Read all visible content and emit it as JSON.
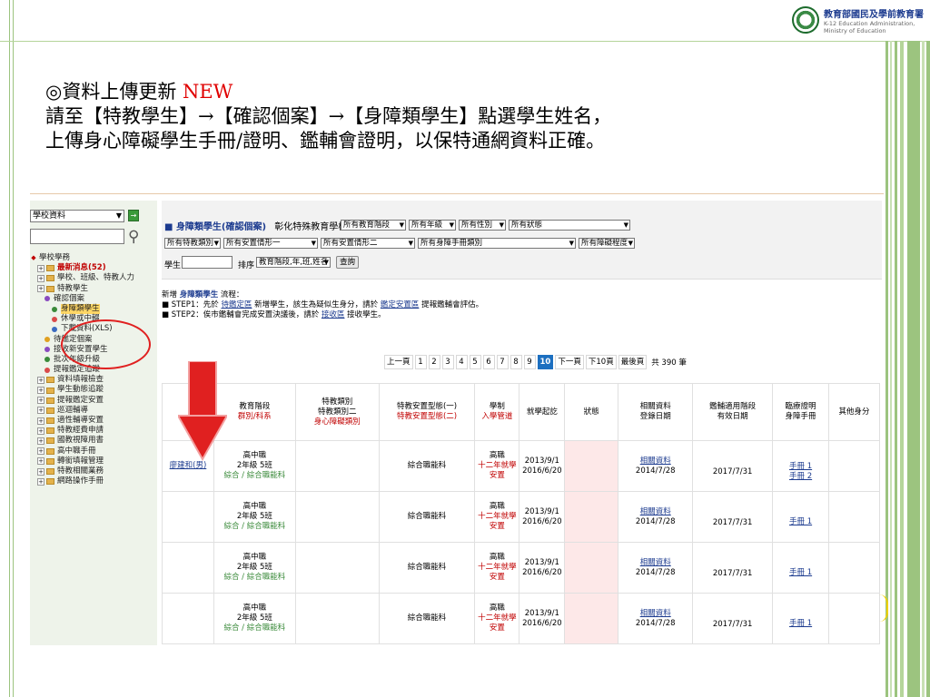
{
  "logo": {
    "title": "教育部國民及學前教育署",
    "en_line1": "K-12 Education Administration,",
    "en_line2": "Ministry of Education"
  },
  "heading": {
    "line1_prefix": "◎資料上傳更新 ",
    "line1_new": "NEW",
    "line2": "請至【特教學生】→【確認個案】→【身障類學生】點選學生姓名，",
    "line3": "上傳身心障礙學生手冊/證明、鑑輔會證明，以保特通網資料正確。"
  },
  "sidebar": {
    "select_value": "學校資料",
    "tree": [
      {
        "label": "學校學務",
        "indent": 0,
        "kind": "root"
      },
      {
        "label": "最新消息(52)",
        "indent": 1,
        "kind": "folder",
        "red": true
      },
      {
        "label": "學校、班級、特教人力",
        "indent": 1,
        "kind": "folder"
      },
      {
        "label": "特教學生",
        "indent": 1,
        "kind": "folder"
      },
      {
        "label": "確認個案",
        "indent": 2,
        "kind": "dot"
      },
      {
        "label": "身障類學生",
        "indent": 3,
        "kind": "dot",
        "selected": true
      },
      {
        "label": "休學或中輟",
        "indent": 3,
        "kind": "dot"
      },
      {
        "label": "下載資料(XLS)",
        "indent": 3,
        "kind": "dot"
      },
      {
        "label": "待鑑定個案",
        "indent": 2,
        "kind": "dot"
      },
      {
        "label": "接收新安置學生",
        "indent": 2,
        "kind": "dot"
      },
      {
        "label": "批次年級升級",
        "indent": 2,
        "kind": "dot"
      },
      {
        "label": "提報鑑定追蹤",
        "indent": 2,
        "kind": "dot"
      },
      {
        "label": "資料填報檢查",
        "indent": 1,
        "kind": "folder"
      },
      {
        "label": "學生動態追蹤",
        "indent": 1,
        "kind": "folder"
      },
      {
        "label": "提報鑑定安置",
        "indent": 1,
        "kind": "folder"
      },
      {
        "label": "巡迴輔導",
        "indent": 1,
        "kind": "folder"
      },
      {
        "label": "適性輔導安置",
        "indent": 1,
        "kind": "folder"
      },
      {
        "label": "特教經費申請",
        "indent": 1,
        "kind": "folder"
      },
      {
        "label": "國教視障用書",
        "indent": 1,
        "kind": "folder"
      },
      {
        "label": "高中職手冊",
        "indent": 1,
        "kind": "folder"
      },
      {
        "label": "轉銜填報管理",
        "indent": 1,
        "kind": "folder"
      },
      {
        "label": "特教相關業務",
        "indent": 1,
        "kind": "folder"
      },
      {
        "label": "網路操作手冊",
        "indent": 1,
        "kind": "folder"
      }
    ]
  },
  "filter": {
    "title_prefix": "■ ",
    "title_bold": "身障類學生(確認個案)",
    "title_school": "彰化特殊教育學校",
    "sel_stage": "所有教育階段",
    "sel_grade": "所有年級",
    "sel_gender": "所有性別",
    "sel_status": "所有狀態",
    "sel_type": "所有特教類別",
    "sel_place1": "所有安置情形一",
    "sel_place2": "所有安置情形二",
    "sel_manual": "所有身障手冊類別",
    "sel_degree": "所有障礙程度",
    "student_label": "學生",
    "sort_label": "排序",
    "sort_value": "教育階段,年,班,姓名",
    "query_button": "查詢"
  },
  "steps": {
    "line0_prefix": "新增 ",
    "line0_bold": "身障類學生",
    "line0_suffix": " 流程：",
    "step1_a": "■ STEP1：先於 ",
    "step1_link1": "待鑑定區",
    "step1_b": " 新增學生，該生為疑似生身分，請於 ",
    "step1_link2": "鑑定安置區",
    "step1_c": " 提報鑑輔會評估。",
    "step2_a": "■ STEP2：俟市鑑輔會完成安置決議後，請於 ",
    "step2_link": "接收區",
    "step2_b": " 接收學生。"
  },
  "pager": {
    "prev": "上一頁",
    "pages": [
      "1",
      "2",
      "3",
      "4",
      "5",
      "6",
      "7",
      "8",
      "9",
      "10"
    ],
    "current": "10",
    "next": "下一頁",
    "next10": "下10頁",
    "last": "最後頁",
    "total": "共 390 筆"
  },
  "table": {
    "headers": {
      "col2_l1": "教育階段",
      "col2_l2": "群別/科系",
      "col3_l1": "特教類別",
      "col3_l2": "特教類別二",
      "col3_l3": "身心障礙類別",
      "col4_l1": "特教安置型態(一)",
      "col4_l2": "特教安置型態(二)",
      "col5_l1": "學制",
      "col5_l2": "入學管道",
      "col6": "就學起訖",
      "col7": "狀態",
      "col8_l1": "相關資料",
      "col8_l2": "登錄日期",
      "col9_l1": "鑑輔適用階段",
      "col9_l2": "有效日期",
      "col10_l1": "臨療證明",
      "col10_l2": "身障手冊",
      "col11": "其他身分"
    },
    "rows": [
      {
        "name": "廖建和(男)",
        "stage": "高中職",
        "class": "2年級 5班",
        "dept": "綜合 / 綜合職能科",
        "place": "綜合職能科",
        "system": "高職",
        "entry": "十二年就學安置",
        "start": "2013/9/1",
        "end": "2016/6/20",
        "data_link": "相關資料",
        "data_date": "2014/7/28",
        "valid": "2017/7/31",
        "manual1": "手冊 1",
        "manual2": "手冊 2"
      },
      {
        "name": "",
        "stage": "高中職",
        "class": "2年級 5班",
        "dept": "綜合 / 綜合職能科",
        "place": "綜合職能科",
        "system": "高職",
        "entry": "十二年就學安置",
        "start": "2013/9/1",
        "end": "2016/6/20",
        "data_link": "相關資料",
        "data_date": "2014/7/28",
        "valid": "2017/7/31",
        "manual1": "手冊 1",
        "manual2": ""
      },
      {
        "name": "",
        "stage": "高中職",
        "class": "2年級 5班",
        "dept": "綜合 / 綜合職能科",
        "place": "綜合職能科",
        "system": "高職",
        "entry": "十二年就學安置",
        "start": "2013/9/1",
        "end": "2016/6/20",
        "data_link": "相關資料",
        "data_date": "2014/7/28",
        "valid": "2017/7/31",
        "manual1": "手冊 1",
        "manual2": ""
      },
      {
        "name": "",
        "stage": "高中職",
        "class": "2年級 5班",
        "dept": "綜合 / 綜合職能科",
        "place": "綜合職能科",
        "system": "高職",
        "entry": "十二年就學安置",
        "start": "2013/9/1",
        "end": "2016/6/20",
        "data_link": "相關資料",
        "data_date": "2014/7/28",
        "valid": "2017/7/31",
        "manual1": "手冊 1",
        "manual2": ""
      }
    ]
  },
  "colors": {
    "accent_red": "#c00000",
    "link_blue": "#1c3b8f",
    "frame_green": "#9cc47f",
    "annotation_red": "#e02020"
  }
}
